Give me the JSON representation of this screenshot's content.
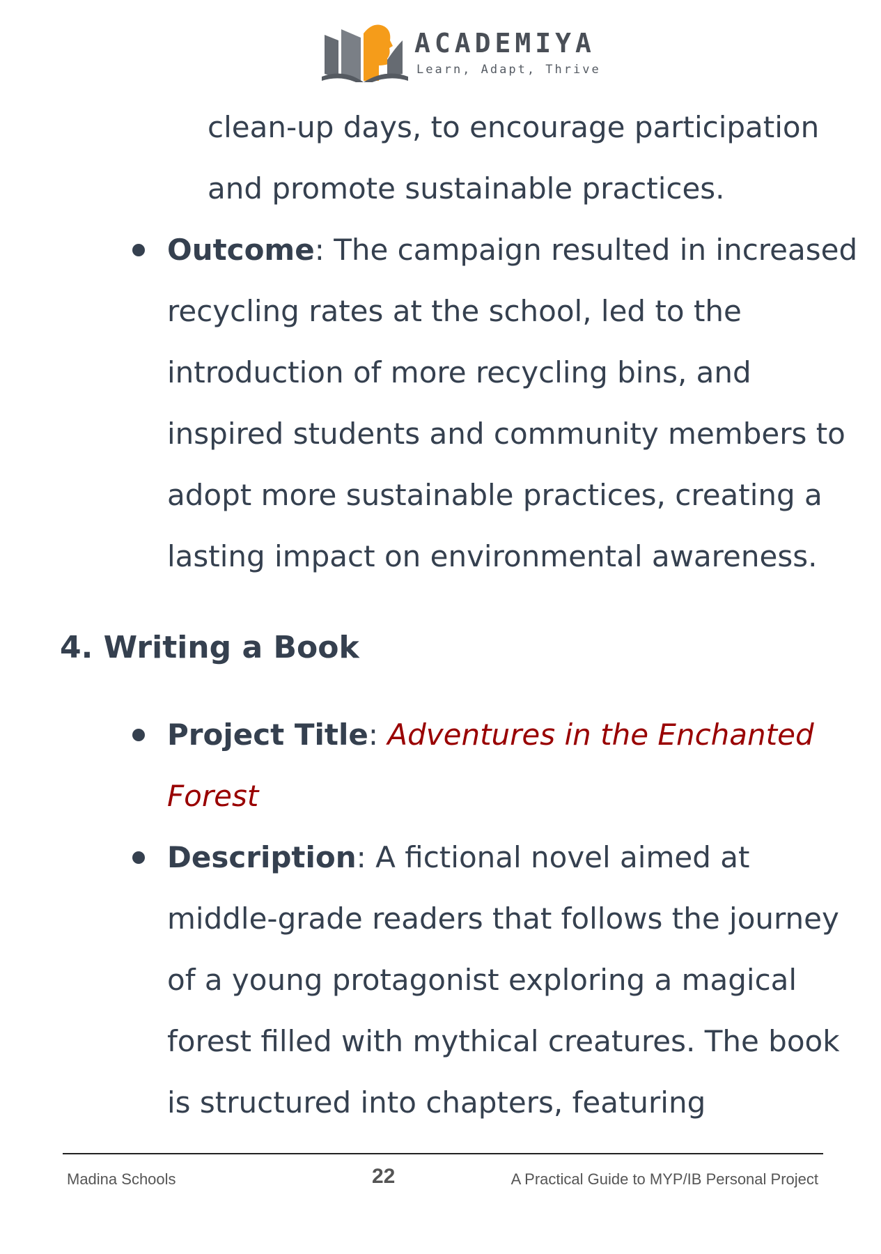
{
  "header": {
    "brand_name": "ACADEMIYA",
    "tagline": "Learn, Adapt, Thrive",
    "logo_icon": "open-book-with-head-silhouette-icon",
    "colors": {
      "book_gray": "#666b72",
      "accent_orange": "#f59c1a"
    }
  },
  "continuation_lines": [
    "clean-up days, to encourage participation",
    "and promote sustainable practices."
  ],
  "outcome": {
    "label": "Outcome",
    "separator": ": ",
    "lines": [
      "The campaign resulted in increased",
      "recycling rates at the school, led to the",
      "introduction of more recycling bins, and",
      "inspired students and community members to",
      "adopt more sustainable practices, creating a",
      "lasting impact on environmental awareness."
    ]
  },
  "section": {
    "heading": "4. Writing a Book",
    "project_title": {
      "label": "Project Title",
      "separator": ": ",
      "lines": [
        "Adventures in the Enchanted",
        "Forest"
      ],
      "color": "#990000"
    },
    "description": {
      "label": "Description",
      "separator": ": ",
      "lines": [
        "A fictional novel aimed at",
        "middle-grade readers that follows the journey",
        "of a young protagonist exploring a magical",
        "forest filled with mythical creatures. The book",
        "is structured into chapters, featuring"
      ]
    }
  },
  "footer": {
    "left": "Madina Schools",
    "page_number": "22",
    "right": "A Practical Guide to MYP/IB  Personal Project"
  }
}
